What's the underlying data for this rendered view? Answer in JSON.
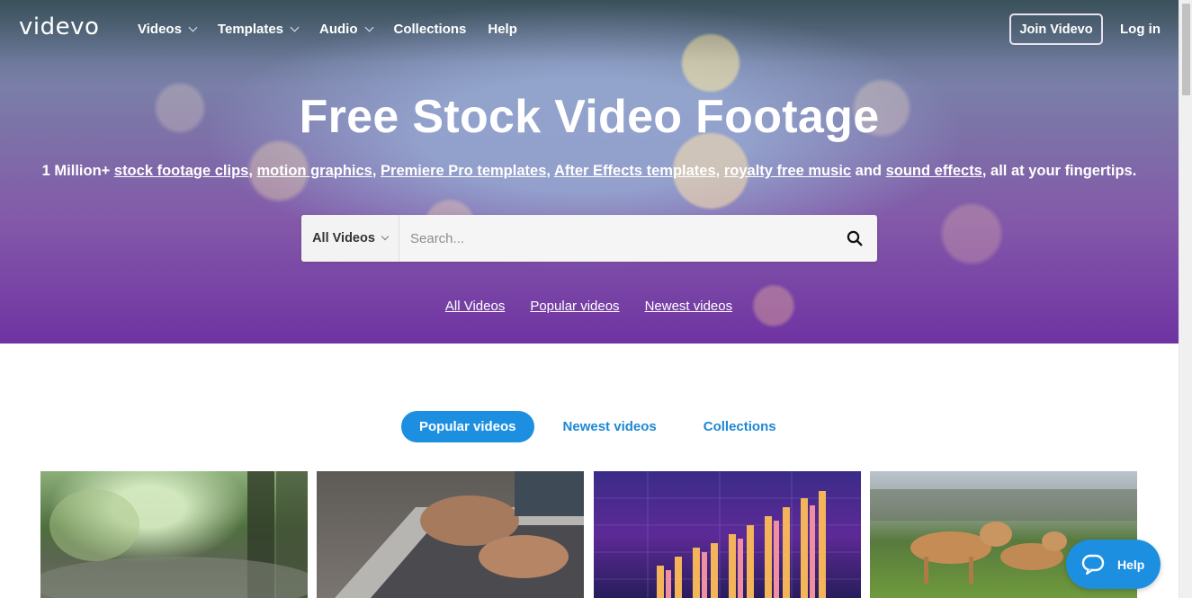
{
  "nav": {
    "logo": "videvo",
    "items": [
      {
        "label": "Videos",
        "dropdown": true
      },
      {
        "label": "Templates",
        "dropdown": true
      },
      {
        "label": "Audio",
        "dropdown": true
      },
      {
        "label": "Collections",
        "dropdown": false
      },
      {
        "label": "Help",
        "dropdown": false
      }
    ],
    "join_label": "Join Videvo",
    "login_label": "Log in"
  },
  "hero": {
    "title": "Free Stock Video Footage",
    "subtitle": {
      "prefix": "1 Million+ ",
      "link_stock_footage": "stock footage clips",
      "sep1": ", ",
      "link_motion_graphics": "motion graphics",
      "sep2": ", ",
      "link_premiere": "Premiere Pro templates",
      "sep3": ", ",
      "link_after_effects": "After Effects templates",
      "sep4": ", ",
      "link_music": "royalty free music",
      "and": " and ",
      "link_sfx": "sound effects",
      "suffix": ", all at your fingertips."
    },
    "search": {
      "category": "All Videos",
      "placeholder": "Search...",
      "value": ""
    },
    "links": [
      "All Videos",
      "Popular videos",
      "Newest videos"
    ]
  },
  "tabs": [
    {
      "label": "Popular videos",
      "active": true
    },
    {
      "label": "Newest videos",
      "active": false
    },
    {
      "label": "Collections",
      "active": false
    }
  ],
  "thumbnails": [
    {
      "icon": "rain-forest-thumbnail"
    },
    {
      "icon": "laptop-typing-thumbnail"
    },
    {
      "icon": "financial-chart-thumbnail"
    },
    {
      "icon": "lionesses-thumbnail"
    }
  ],
  "help_widget": {
    "label": "Help"
  },
  "colors": {
    "accent": "#1d8fe1",
    "tab_text": "#1d87d5"
  }
}
